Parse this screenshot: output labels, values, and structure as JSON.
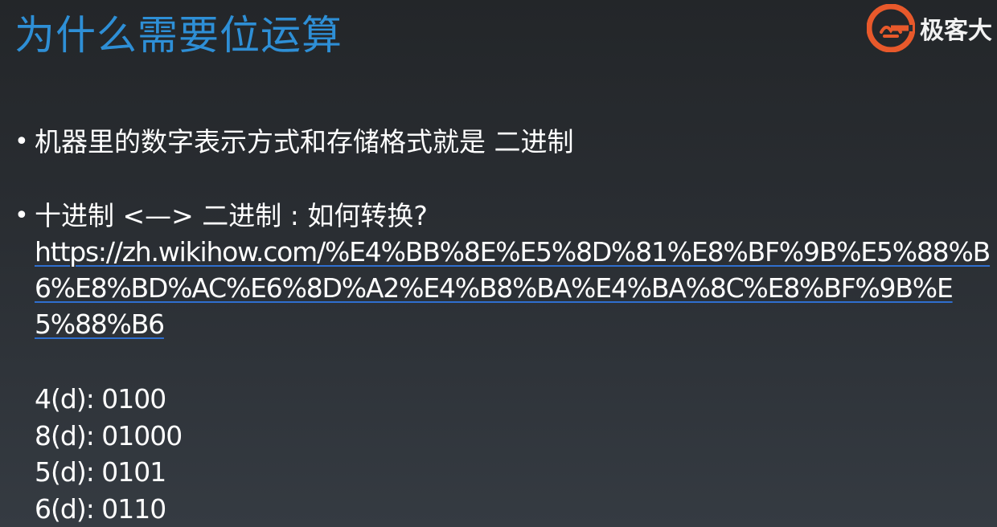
{
  "title": "为什么需要位运算",
  "logo": {
    "text": "极客大",
    "color": "#e8592b"
  },
  "bullets": [
    {
      "text": "机器里的数字表示方式和存储格式就是 二进制"
    },
    {
      "text": "十进制 <—> 二进制 : 如何转换?"
    }
  ],
  "link": {
    "url": "https://zh.wikihow.com/%E4%BB%8E%E5%8D%81%E8%BF%9B%E5%88%B6%E8%BD%AC%E6%8D%A2%E4%B8%BA%E4%BA%8C%E8%BF%9B%E5%88%B6"
  },
  "examples": [
    "4(d): 0100",
    "8(d): 01000",
    "5(d): 0101",
    "6(d): 0110"
  ],
  "colors": {
    "title": "#2e8fd6",
    "link_underline": "#2f6fcf",
    "text": "#ffffff"
  }
}
